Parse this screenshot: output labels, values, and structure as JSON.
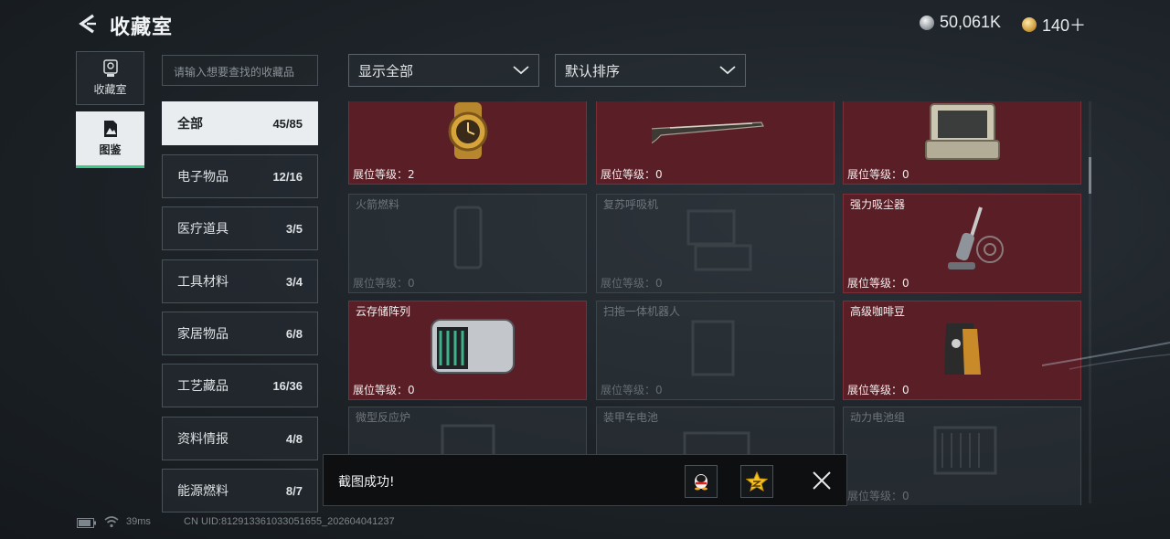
{
  "header": {
    "title": "收藏室"
  },
  "currency": {
    "silver": "50,061K",
    "gold": "140＋"
  },
  "nav": [
    {
      "label": "收藏室",
      "icon": "trophy-icon",
      "active": false
    },
    {
      "label": "图鉴",
      "icon": "album-icon",
      "active": true
    }
  ],
  "search": {
    "placeholder": "请输入想要查找的收藏品"
  },
  "categories": [
    {
      "label": "全部",
      "count": "45/85",
      "active": true
    },
    {
      "label": "电子物品",
      "count": "12/16"
    },
    {
      "label": "医疗道具",
      "count": "3/5"
    },
    {
      "label": "工具材料",
      "count": "3/4"
    },
    {
      "label": "家居物品",
      "count": "6/8"
    },
    {
      "label": "工艺藏品",
      "count": "16/36"
    },
    {
      "label": "资料情报",
      "count": "4/8"
    },
    {
      "label": "能源燃料",
      "count": "8/7"
    }
  ],
  "filters": {
    "display": "显示全部",
    "sort": "默认排序"
  },
  "items": [
    {
      "name": "",
      "level": "展位等级：2",
      "owned": true,
      "icon": "gold-watch-icon"
    },
    {
      "name": "",
      "level": "展位等级：0",
      "owned": true,
      "icon": "antique-musket-icon"
    },
    {
      "name": "",
      "level": "展位等级：0",
      "owned": true,
      "icon": "rugged-laptop-case-icon"
    },
    {
      "name": "火箭燃料",
      "level": "展位等级：0",
      "owned": false,
      "icon": "rocket-fuel-icon"
    },
    {
      "name": "复苏呼吸机",
      "level": "展位等级：0",
      "owned": false,
      "icon": "ventilator-icon"
    },
    {
      "name": "强力吸尘器",
      "level": "展位等级：0",
      "owned": true,
      "icon": "vacuum-cleaner-icon"
    },
    {
      "name": "云存储阵列",
      "level": "展位等级：0",
      "owned": true,
      "icon": "storage-array-icon"
    },
    {
      "name": "扫拖一体机器人",
      "level": "展位等级：0",
      "owned": false,
      "icon": "robot-mop-icon"
    },
    {
      "name": "高级咖啡豆",
      "level": "展位等级：0",
      "owned": true,
      "icon": "coffee-bag-icon"
    },
    {
      "name": "微型反应炉",
      "level": "",
      "owned": false,
      "icon": "micro-reactor-icon"
    },
    {
      "name": "装甲车电池",
      "level": "",
      "owned": false,
      "icon": "vehicle-battery-icon"
    },
    {
      "name": "动力电池组",
      "level": "展位等级：0",
      "owned": false,
      "icon": "battery-pack-icon"
    }
  ],
  "toast": {
    "message": "截图成功!"
  },
  "footer": {
    "ping": "39ms",
    "uid": "CN UID:812913361033051655_202604041237"
  }
}
